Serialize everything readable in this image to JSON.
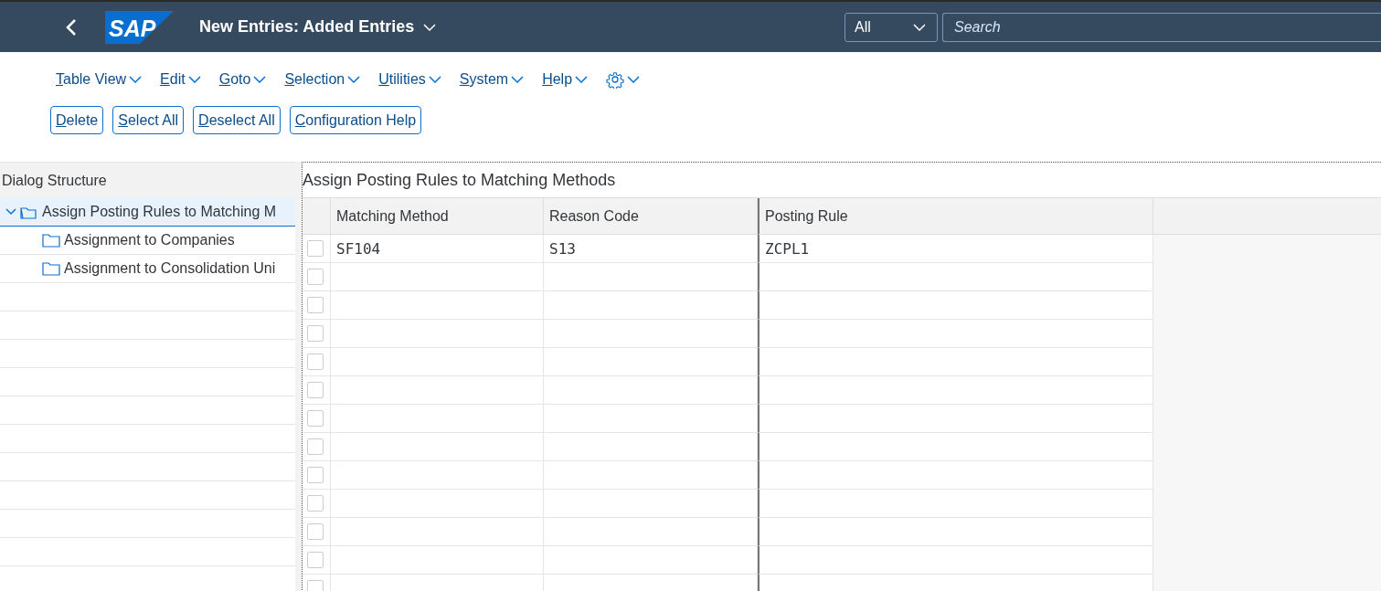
{
  "shell_bar": {
    "logo": "SAP",
    "title": "New Entries: Added Entries",
    "search_scope": "All",
    "search": {
      "placeholder": "Search"
    }
  },
  "menu": [
    {
      "label": "Table View"
    },
    {
      "label": "Edit"
    },
    {
      "label": "Goto"
    },
    {
      "label": "Selection"
    },
    {
      "label": "Utilities"
    },
    {
      "label": "System"
    },
    {
      "label": "Help"
    },
    {
      "kind": "settings"
    }
  ],
  "toolbar": [
    "Delete",
    "Select All",
    "Deselect All",
    "Configuration Help"
  ],
  "dialog_structure": {
    "title": "Dialog Structure",
    "tree": [
      {
        "label": "Assign Posting Rules to Matching M",
        "expanded": true,
        "selected": true,
        "children": [
          {
            "label": "Assignment to Companies",
            "selected": false
          },
          {
            "label": "Assignment to Consolidation Uni",
            "selected": false
          }
        ]
      }
    ]
  },
  "table": {
    "title": "Assign Posting Rules to Matching Methods",
    "columns": [
      "Matching Method",
      "Reason Code",
      "Posting Rule"
    ],
    "rows": [
      {
        "selected": false,
        "cells": [
          "SF104",
          "S13",
          "ZCPL1"
        ]
      },
      {
        "selected": false
      },
      {
        "selected": false
      },
      {
        "selected": false
      },
      {
        "selected": false
      },
      {
        "selected": false
      },
      {
        "selected": false
      },
      {
        "selected": false
      },
      {
        "selected": false
      },
      {
        "selected": false
      },
      {
        "selected": false
      },
      {
        "selected": false
      },
      {
        "selected": false
      }
    ]
  }
}
